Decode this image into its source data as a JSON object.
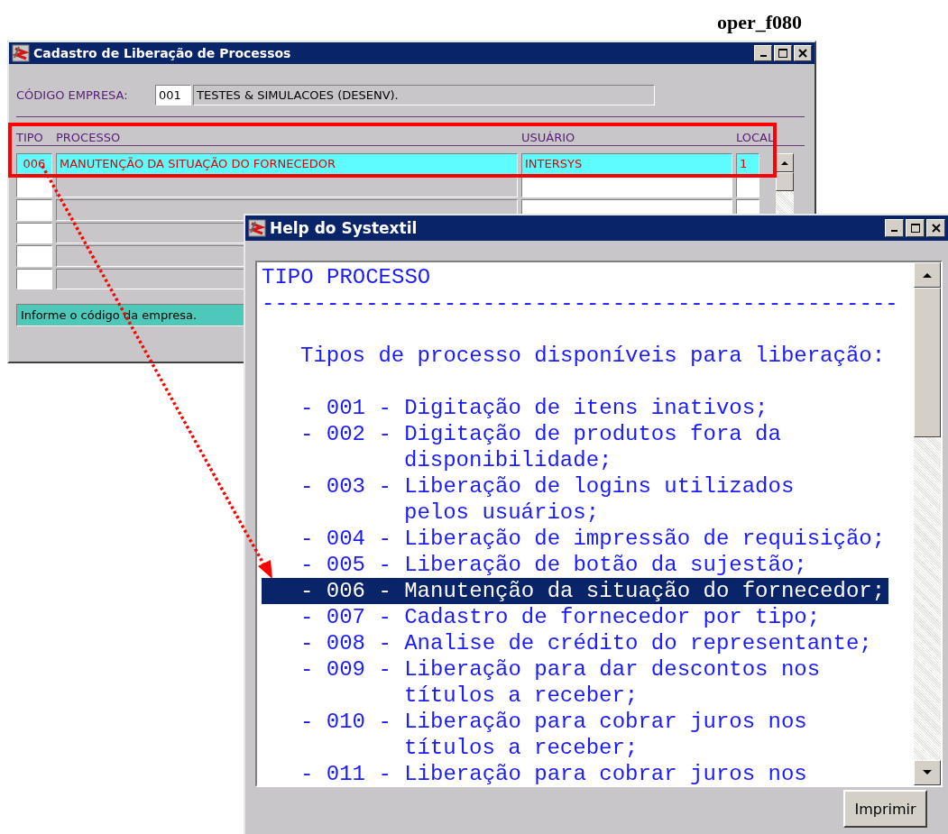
{
  "caption": "oper_f080",
  "main_window": {
    "title": "Cadastro de Liberação de Processos",
    "company": {
      "label": "CÓDIGO EMPRESA:",
      "code": "001",
      "name": "TESTES & SIMULACOES (DESENV)."
    },
    "table": {
      "columns": [
        "TIPO",
        "PROCESSO",
        "USUÁRIO",
        "LOCAL"
      ],
      "rows": [
        {
          "tipo": "006",
          "processo": "MANUTENÇÃO DA SITUAÇÃO DO FORNECEDOR",
          "usuario": "INTERSYS",
          "local": "1",
          "selected": true
        },
        {
          "selected": false
        },
        {
          "selected": false
        },
        {
          "selected": false
        },
        {
          "selected": false
        },
        {
          "selected": false
        }
      ]
    },
    "status_bar": "Informe o código da empresa."
  },
  "help_window": {
    "title": "Help do Systextil",
    "heading": "TIPO PROCESSO",
    "rule": "-------------------------------------------------",
    "intro": "Tipos de processo disponíveis para liberação:",
    "items": [
      {
        "lines": [
          "- 001 - Digitação de itens inativos;"
        ],
        "selected": false
      },
      {
        "lines": [
          "- 002 - Digitação de produtos fora da",
          "disponibilidade;"
        ],
        "selected": false
      },
      {
        "lines": [
          "- 003 - Liberação de logins utilizados",
          "pelos usuários;"
        ],
        "selected": false
      },
      {
        "lines": [
          "- 004 - Liberação de impressão de requisição;"
        ],
        "selected": false
      },
      {
        "lines": [
          "- 005 - Liberação de botão da sujestão;"
        ],
        "selected": false
      },
      {
        "lines": [
          "- 006 - Manutenção da situação do fornecedor;"
        ],
        "selected": true
      },
      {
        "lines": [
          "- 007 - Cadastro de fornecedor por tipo;"
        ],
        "selected": false
      },
      {
        "lines": [
          "- 008 - Analise de crédito do representante;"
        ],
        "selected": false
      },
      {
        "lines": [
          "- 009 - Liberação para dar descontos nos",
          "títulos a receber;"
        ],
        "selected": false
      },
      {
        "lines": [
          "- 010 - Liberação para cobrar juros nos",
          "títulos a receber;"
        ],
        "selected": false
      },
      {
        "lines": [
          "- 011 - Liberação para cobrar juros nos"
        ],
        "selected": false
      }
    ],
    "button": "Imprimir"
  }
}
